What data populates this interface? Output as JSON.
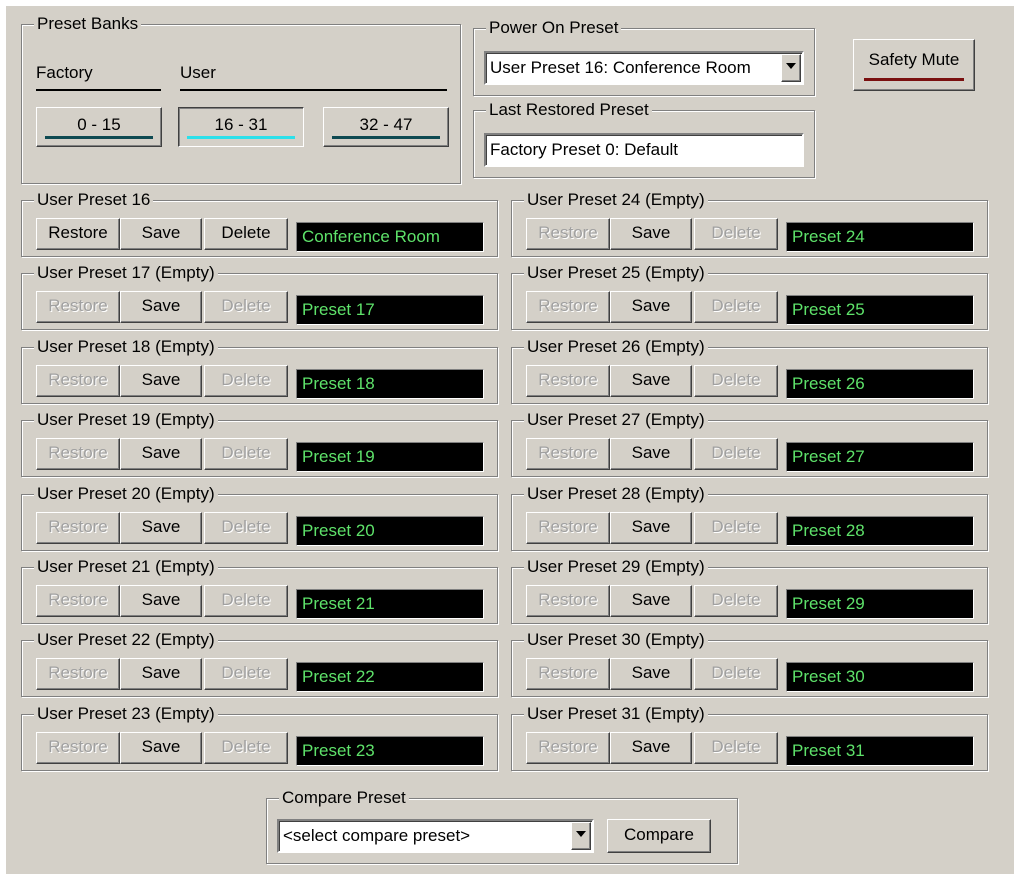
{
  "preset_banks": {
    "title": "Preset Banks",
    "factory_label": "Factory",
    "user_label": "User",
    "buttons": [
      "0 - 15",
      "16 - 31",
      "32 - 47"
    ],
    "active_index": 1,
    "bar_color": "#0e4a52",
    "active_bar_color": "#2ce0ea"
  },
  "power_on": {
    "title": "Power On Preset",
    "selected": "User Preset 16: Conference Room"
  },
  "last_restored": {
    "title": "Last Restored Preset",
    "value": "Factory Preset 0: Default"
  },
  "safety_mute": {
    "label": "Safety Mute",
    "indicator_color": "#7a1010"
  },
  "buttons": {
    "restore": "Restore",
    "save": "Save",
    "delete": "Delete"
  },
  "name_colors": {
    "background": "#000000",
    "text": "#5ee26a"
  },
  "presets": [
    {
      "title": "User Preset 16",
      "name": "Conference Room",
      "empty": false
    },
    {
      "title": "User Preset 17 (Empty)",
      "name": "Preset 17",
      "empty": true
    },
    {
      "title": "User Preset 18 (Empty)",
      "name": "Preset 18",
      "empty": true
    },
    {
      "title": "User Preset 19 (Empty)",
      "name": "Preset 19",
      "empty": true
    },
    {
      "title": "User Preset 20 (Empty)",
      "name": "Preset 20",
      "empty": true
    },
    {
      "title": "User Preset 21 (Empty)",
      "name": "Preset 21",
      "empty": true
    },
    {
      "title": "User Preset 22 (Empty)",
      "name": "Preset 22",
      "empty": true
    },
    {
      "title": "User Preset 23 (Empty)",
      "name": "Preset 23",
      "empty": true
    },
    {
      "title": "User Preset 24 (Empty)",
      "name": "Preset 24",
      "empty": true
    },
    {
      "title": "User Preset 25 (Empty)",
      "name": "Preset 25",
      "empty": true
    },
    {
      "title": "User Preset 26 (Empty)",
      "name": "Preset 26",
      "empty": true
    },
    {
      "title": "User Preset 27 (Empty)",
      "name": "Preset 27",
      "empty": true
    },
    {
      "title": "User Preset 28 (Empty)",
      "name": "Preset 28",
      "empty": true
    },
    {
      "title": "User Preset 29 (Empty)",
      "name": "Preset 29",
      "empty": true
    },
    {
      "title": "User Preset 30 (Empty)",
      "name": "Preset 30",
      "empty": true
    },
    {
      "title": "User Preset 31 (Empty)",
      "name": "Preset 31",
      "empty": true
    }
  ],
  "compare": {
    "title": "Compare Preset",
    "selected": "<select compare preset>",
    "button_label": "Compare"
  }
}
